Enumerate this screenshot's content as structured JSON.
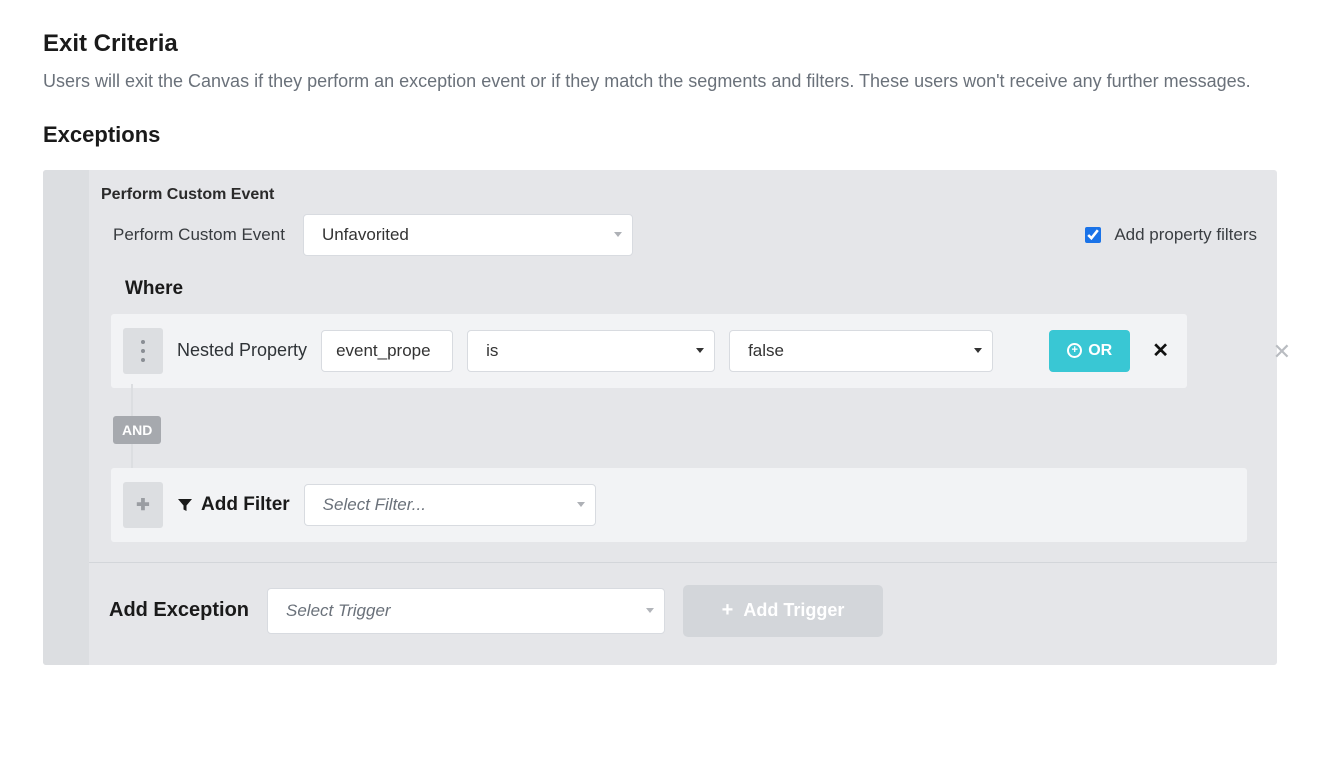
{
  "exit_criteria": {
    "title": "Exit Criteria",
    "description": "Users will exit the Canvas if they perform an exception event or if they match the segments and filters. These users won't receive any further messages."
  },
  "exceptions": {
    "title": "Exceptions",
    "event_block": {
      "header": "Perform Custom Event",
      "label": "Perform Custom Event",
      "selected_event": "Unfavorited",
      "add_property_filters": {
        "label": "Add property filters",
        "checked": true
      }
    },
    "where": {
      "title": "Where",
      "filter": {
        "type_label": "Nested Property",
        "property_value": "event_prope",
        "operator": "is",
        "value": "false",
        "or_button": "OR"
      },
      "connector": "AND",
      "add_filter": {
        "label": "Add Filter",
        "placeholder": "Select Filter..."
      }
    },
    "footer": {
      "label": "Add Exception",
      "trigger_placeholder": "Select Trigger",
      "add_trigger_button": "Add Trigger"
    }
  }
}
